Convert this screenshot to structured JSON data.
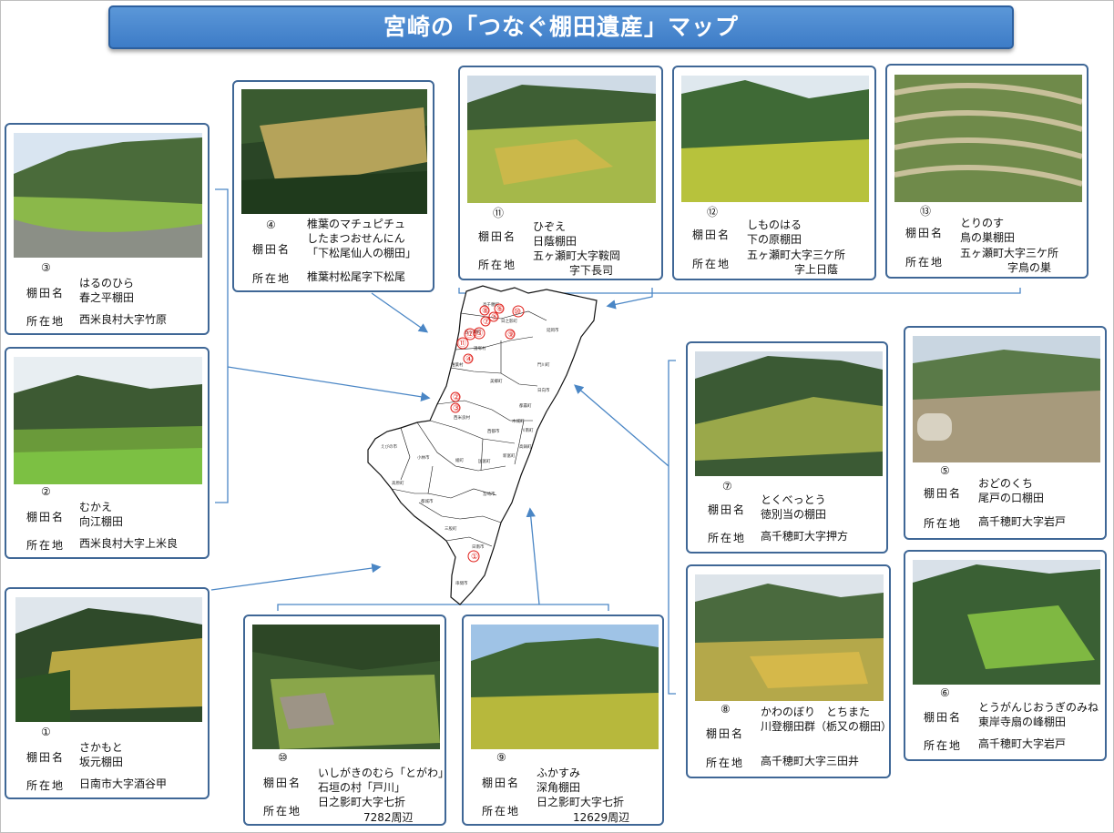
{
  "title": "宮崎の「つなぐ棚田遺産」マップ",
  "field_labels": {
    "name": "棚田名",
    "location": "所在地"
  },
  "cards": [
    {
      "id": "3",
      "number": "③",
      "name_lines": [
        "はるのひら",
        "春之平棚田"
      ],
      "location_lines": [
        "西米良村大字竹原"
      ]
    },
    {
      "id": "2",
      "number": "②",
      "name_lines": [
        "むかえ",
        "向江棚田"
      ],
      "location_lines": [
        "西米良村大字上米良"
      ]
    },
    {
      "id": "1",
      "number": "①",
      "name_lines": [
        "さかもと",
        "坂元棚田"
      ],
      "location_lines": [
        "日南市大字酒谷甲"
      ]
    },
    {
      "id": "4",
      "number": "④",
      "name_lines": [
        "椎葉のマチュピチュ",
        "したまつおせんにん",
        "「下松尾仙人の棚田」"
      ],
      "location_lines": [
        "椎葉村松尾字下松尾"
      ]
    },
    {
      "id": "11",
      "number": "⑪",
      "name_lines": [
        "ひぞえ",
        "日蔭棚田"
      ],
      "location_lines": [
        "五ヶ瀬町大字鞍岡",
        "字下長司"
      ]
    },
    {
      "id": "12",
      "number": "⑫",
      "name_lines": [
        "しものはる",
        "下の原棚田"
      ],
      "location_lines": [
        "五ヶ瀬町大字三ケ所",
        "字上日蔭"
      ]
    },
    {
      "id": "13",
      "number": "⑬",
      "name_lines": [
        "とりのす",
        "鳥の巣棚田"
      ],
      "location_lines": [
        "五ヶ瀬町大字三ケ所",
        "字鳥の巣"
      ]
    },
    {
      "id": "7",
      "number": "⑦",
      "name_lines": [
        "とくべっとう",
        "徳別当の棚田"
      ],
      "location_lines": [
        "高千穂町大字押方"
      ]
    },
    {
      "id": "5",
      "number": "⑤",
      "name_lines": [
        "おどのくち",
        "尾戸の口棚田"
      ],
      "location_lines": [
        "高千穂町大字岩戸"
      ]
    },
    {
      "id": "8",
      "number": "⑧",
      "name_lines": [
        "かわのぼり　とちまた",
        "川登棚田群（栃又の棚田）"
      ],
      "location_lines": [
        "高千穂町大字三田井"
      ]
    },
    {
      "id": "6",
      "number": "⑥",
      "name_lines": [
        "とうがんじおうぎのみね",
        "東岸寺扇の峰棚田"
      ],
      "location_lines": [
        "高千穂町大字岩戸"
      ]
    },
    {
      "id": "10",
      "number": "⑩",
      "name_lines": [
        "いしがきのむら「とがわ」",
        "石垣の村「戸川」",
        "日之影町大字七折"
      ],
      "location_lines": [
        "7282周辺"
      ]
    },
    {
      "id": "9",
      "number": "⑨",
      "name_lines": [
        "ふかすみ",
        "深角棚田",
        "日之影町大字七折"
      ],
      "location_lines": [
        "12629周辺"
      ]
    }
  ],
  "map": {
    "markers": [
      "①",
      "②",
      "③",
      "④",
      "⑤",
      "⑥",
      "⑦",
      "⑧",
      "⑨",
      "⑩",
      "⑪",
      "⑫",
      "⑬"
    ],
    "municipalities": [
      "五ヶ瀬町",
      "高千穂町",
      "日之影町",
      "延岡市",
      "椎葉村",
      "門川町",
      "美郷町",
      "日向市",
      "西米良村",
      "木城町",
      "川南町",
      "都農町",
      "西都市",
      "高鍋町",
      "えびの市",
      "小林市",
      "綾町",
      "国富町",
      "宮崎市",
      "高原町",
      "都城市",
      "三股町",
      "日南市",
      "串間市",
      "諸塚村",
      "新富町"
    ],
    "marker_color": "#e0201b",
    "outline_color": "#111111"
  },
  "colors": {
    "title_bg": "#4a89d2",
    "card_border": "#3f6796",
    "connector": "#4a86c5"
  }
}
